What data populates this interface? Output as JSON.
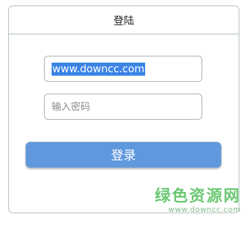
{
  "panel": {
    "title": "登陆"
  },
  "form": {
    "username_value": "www.downcc.com",
    "password_placeholder": "输入密码",
    "login_label": "登录"
  },
  "watermark": {
    "brand": "绿色资源网",
    "url": "www.downcc.com"
  },
  "colors": {
    "button": "#5f98dd",
    "selection": "#3b84e6",
    "border": "#aebfb9",
    "watermark": "#4fbf58"
  }
}
